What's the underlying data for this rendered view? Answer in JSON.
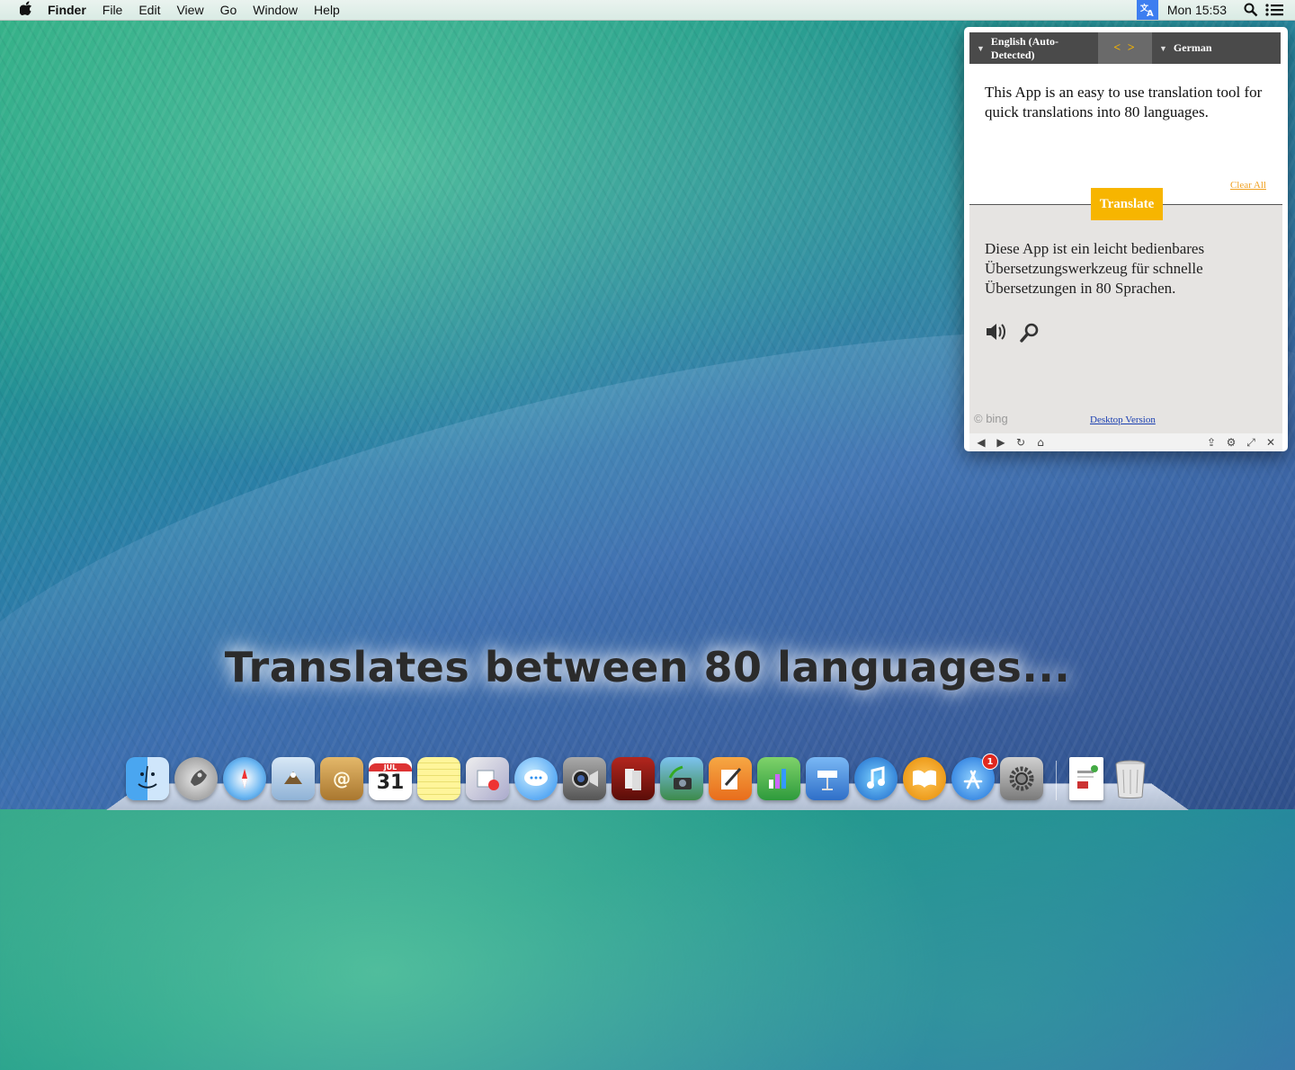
{
  "menubar": {
    "apple_icon": "apple-logo-icon",
    "app_name": "Finder",
    "menus": [
      "File",
      "Edit",
      "View",
      "Go",
      "Window",
      "Help"
    ],
    "clock": "Mon 15:53"
  },
  "translator": {
    "source_lang": "English (Auto-Detected)",
    "target_lang": "German",
    "swap_label": "< >",
    "source_text": "This App is an easy to use translation tool for quick translations into 80 languages.",
    "clear_all": "Clear All",
    "translate_button": "Translate",
    "result_text": "Diese App ist ein leicht bedienbares Übersetzungswerkzeug für schnelle Übersetzungen in 80 Sprachen.",
    "bing_label": "© bing",
    "desktop_version": "Desktop Version",
    "accent_color": "#f7b500"
  },
  "caption": "Translates between 80 languages...",
  "dock": {
    "calendar_day": "31",
    "calendar_month": "JUL",
    "appstore_badge": "1"
  }
}
